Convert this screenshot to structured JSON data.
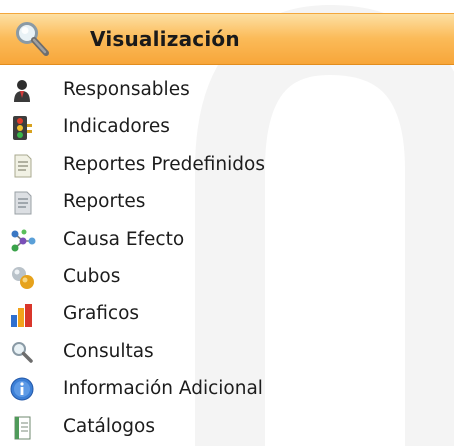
{
  "header": {
    "title": "Visualización",
    "icon": "magnifier-icon",
    "colors": {
      "top": "#fde0a3",
      "bottom": "#f7a63a"
    }
  },
  "items": [
    {
      "label": "Responsables",
      "icon": "person-icon"
    },
    {
      "label": "Indicadores",
      "icon": "traffic-light-icon"
    },
    {
      "label": "Reportes Predefinidos",
      "icon": "report-icon"
    },
    {
      "label": "Reportes",
      "icon": "report-gray-icon"
    },
    {
      "label": "Causa Efecto",
      "icon": "cause-effect-icon"
    },
    {
      "label": "Cubos",
      "icon": "cubes-icon"
    },
    {
      "label": "Graficos",
      "icon": "bar-chart-icon"
    },
    {
      "label": "Consultas",
      "icon": "magnifier-icon"
    },
    {
      "label": "Información Adicional",
      "icon": "info-icon"
    },
    {
      "label": "Catálogos",
      "icon": "catalog-icon"
    }
  ]
}
